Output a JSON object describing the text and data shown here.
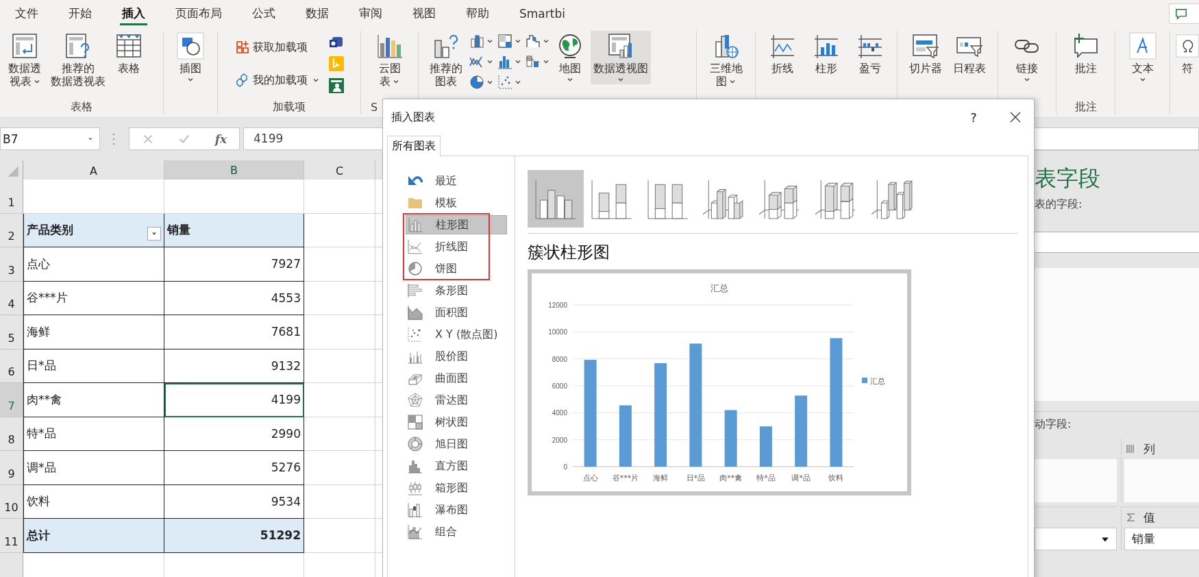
{
  "ribbon": {
    "tabs": [
      {
        "label": "文件",
        "selected": false
      },
      {
        "label": "开始",
        "selected": false
      },
      {
        "label": "插入",
        "selected": true
      },
      {
        "label": "页面布局",
        "selected": false
      },
      {
        "label": "公式",
        "selected": false
      },
      {
        "label": "数据",
        "selected": false
      },
      {
        "label": "审阅",
        "selected": false
      },
      {
        "label": "视图",
        "selected": false
      },
      {
        "label": "帮助",
        "selected": false
      },
      {
        "label": "Smartbi",
        "selected": false
      }
    ],
    "groups": [
      {
        "label": "表格",
        "buttons": [
          {
            "kind": "large",
            "lines": [
              "数据透",
              "视表"
            ],
            "dropdown": true,
            "hovered": false
          },
          {
            "kind": "large",
            "lines": [
              "推荐的",
              "数据透视表"
            ],
            "dropdown": false,
            "hovered": false
          },
          {
            "kind": "large",
            "lines": [
              "表格"
            ],
            "dropdown": false,
            "hovered": false
          }
        ]
      },
      {
        "buttons": [
          {
            "kind": "large",
            "lines": [
              "插图"
            ],
            "dropdown": true,
            "hovered": false
          }
        ]
      },
      {
        "label": "加载项",
        "buttons": [
          {
            "kind": "stack",
            "buttons": [
              {
                "kind": "small",
                "label": "获取加载项",
                "dropdown": false
              },
              {
                "kind": "small",
                "label": "我的加载项",
                "dropdown": true
              }
            ]
          },
          {
            "kind": "stack",
            "buttons": [
              {
                "kind": "icon"
              },
              {
                "kind": "icon"
              },
              {
                "kind": "icon"
              }
            ]
          }
        ]
      },
      {
        "label": "S",
        "buttons": [
          {
            "kind": "large",
            "lines": [
              "云图",
              "表"
            ],
            "dropdown": true,
            "hovered": false
          }
        ]
      },
      {
        "buttons": [
          {
            "kind": "large",
            "lines": [
              "推荐的",
              "图表"
            ],
            "dropdown": false,
            "hovered": false
          },
          {
            "kind": "stack",
            "buttons": [
              {
                "kind": "icon",
                "dropdown": true
              },
              {
                "kind": "icon",
                "dropdown": true
              },
              {
                "kind": "icon",
                "dropdown": true
              }
            ]
          },
          {
            "kind": "stack",
            "buttons": [
              {
                "kind": "icon",
                "dropdown": true
              },
              {
                "kind": "icon",
                "dropdown": true
              },
              {
                "kind": "icon",
                "dropdown": true
              }
            ]
          },
          {
            "kind": "stack",
            "buttons": [
              {
                "kind": "icon",
                "dropdown": true
              },
              {
                "kind": "icon",
                "dropdown": true
              }
            ]
          },
          {
            "kind": "large",
            "lines": [
              "地图"
            ],
            "dropdown": true,
            "hovered": false
          },
          {
            "kind": "large",
            "lines": [
              "数据透视图"
            ],
            "dropdown": true,
            "hovered": true
          }
        ]
      },
      {
        "buttons": [
          {
            "kind": "large",
            "lines": [
              "三维地",
              "图"
            ],
            "dropdown": true,
            "hovered": false
          }
        ]
      },
      {
        "buttons": [
          {
            "kind": "large",
            "lines": [
              "折线"
            ],
            "dropdown": false,
            "hovered": false
          },
          {
            "kind": "large",
            "lines": [
              "柱形"
            ],
            "dropdown": false,
            "hovered": false
          },
          {
            "kind": "large",
            "lines": [
              "盈亏"
            ],
            "dropdown": false,
            "hovered": false
          }
        ]
      },
      {
        "buttons": [
          {
            "kind": "large",
            "lines": [
              "切片器"
            ],
            "dropdown": false,
            "hovered": false
          },
          {
            "kind": "large",
            "lines": [
              "日程表"
            ],
            "dropdown": false,
            "hovered": false
          }
        ]
      },
      {
        "buttons": [
          {
            "kind": "large",
            "lines": [
              "链接"
            ],
            "dropdown": true,
            "hovered": false
          }
        ]
      },
      {
        "label": "批注",
        "buttons": [
          {
            "kind": "large",
            "lines": [
              "批注"
            ],
            "dropdown": false,
            "hovered": false
          }
        ]
      },
      {
        "buttons": [
          {
            "kind": "large",
            "lines": [
              "文本"
            ],
            "dropdown": true,
            "hovered": false
          }
        ]
      },
      {
        "buttons": [
          {
            "kind": "large",
            "lines": [
              "符"
            ],
            "dropdown": false,
            "hovered": false
          }
        ]
      }
    ]
  },
  "formula_bar": {
    "name_box": "B7",
    "function_label": "fx",
    "formula": "4199"
  },
  "sheet": {
    "columns": [
      {
        "label": "A",
        "selected": false
      },
      {
        "label": "B",
        "selected": true
      },
      {
        "label": "C",
        "selected": false
      }
    ],
    "row_numbers": [
      {
        "label": "1",
        "selected": false
      },
      {
        "label": "2",
        "selected": false
      },
      {
        "label": "3",
        "selected": false
      },
      {
        "label": "4",
        "selected": false
      },
      {
        "label": "5",
        "selected": false
      },
      {
        "label": "6",
        "selected": false
      },
      {
        "label": "7",
        "selected": true
      },
      {
        "label": "8",
        "selected": false
      },
      {
        "label": "9",
        "selected": false
      },
      {
        "label": "10",
        "selected": false
      },
      {
        "label": "11",
        "selected": false
      }
    ],
    "table": {
      "header": [
        {
          "label": "产品类别",
          "filter": true
        },
        {
          "label": "销量",
          "filter": false
        }
      ],
      "rows": [
        {
          "cells": [
            "点心",
            "7927"
          ],
          "active": false
        },
        {
          "cells": [
            "谷***片",
            "4553"
          ],
          "active": false
        },
        {
          "cells": [
            "海鲜",
            "7681"
          ],
          "active": false
        },
        {
          "cells": [
            "日*品",
            "9132"
          ],
          "active": false
        },
        {
          "cells": [
            "肉**禽",
            "4199"
          ],
          "active": true
        },
        {
          "cells": [
            "特*品",
            "2990"
          ],
          "active": false
        },
        {
          "cells": [
            "调*品",
            "5276"
          ],
          "active": false
        },
        {
          "cells": [
            "饮料",
            "9534"
          ],
          "active": false
        }
      ],
      "total": [
        "总计",
        "51292"
      ]
    }
  },
  "field_pane": {
    "title": "表字段",
    "subtitle": "表的字段:",
    "drag_hint": "动字段:",
    "areas": [
      {
        "kind": "filters"
      },
      {
        "kind": "columns",
        "label": "列"
      },
      {
        "kind": "rows"
      },
      {
        "kind": "values",
        "label": "值",
        "field": "销量"
      }
    ]
  },
  "dialog": {
    "title": "插入图表",
    "help": "?",
    "tabs": [
      {
        "label": "所有图表",
        "selected": true
      }
    ],
    "chart_types": [
      {
        "label": "最近",
        "selected": false
      },
      {
        "label": "模板",
        "selected": false
      },
      {
        "label": "柱形图",
        "selected": true
      },
      {
        "label": "折线图",
        "selected": false
      },
      {
        "label": "饼图",
        "selected": false
      },
      {
        "label": "条形图",
        "selected": false
      },
      {
        "label": "面积图",
        "selected": false
      },
      {
        "label": "X Y (散点图)",
        "selected": false
      },
      {
        "label": "股价图",
        "selected": false
      },
      {
        "label": "曲面图",
        "selected": false
      },
      {
        "label": "雷达图",
        "selected": false
      },
      {
        "label": "树状图",
        "selected": false
      },
      {
        "label": "旭日图",
        "selected": false
      },
      {
        "label": "直方图",
        "selected": false
      },
      {
        "label": "箱形图",
        "selected": false
      },
      {
        "label": "瀑布图",
        "selected": false
      },
      {
        "label": "组合",
        "selected": false
      }
    ],
    "subtypes": [
      {
        "selected": true
      },
      {
        "selected": false
      },
      {
        "selected": false
      },
      {
        "selected": false
      },
      {
        "selected": false
      },
      {
        "selected": false
      },
      {
        "selected": false
      }
    ],
    "subtype_title": "簇状柱形图",
    "preview": {
      "chart_data": {
        "type": "bar",
        "title": "汇总",
        "categories": [
          "点心",
          "谷***片",
          "海鲜",
          "日*品",
          "肉**禽",
          "特*品",
          "调*品",
          "饮料"
        ],
        "series": [
          {
            "name": "汇总",
            "color": "#5b9bd5",
            "values": [
              7927,
              4553,
              7681,
              9132,
              4199,
              2990,
              5276,
              9534
            ]
          }
        ],
        "grid": true,
        "ylim": [
          0,
          12000
        ],
        "yticks": [
          0,
          2000,
          4000,
          6000,
          8000,
          10000,
          12000
        ]
      }
    }
  }
}
